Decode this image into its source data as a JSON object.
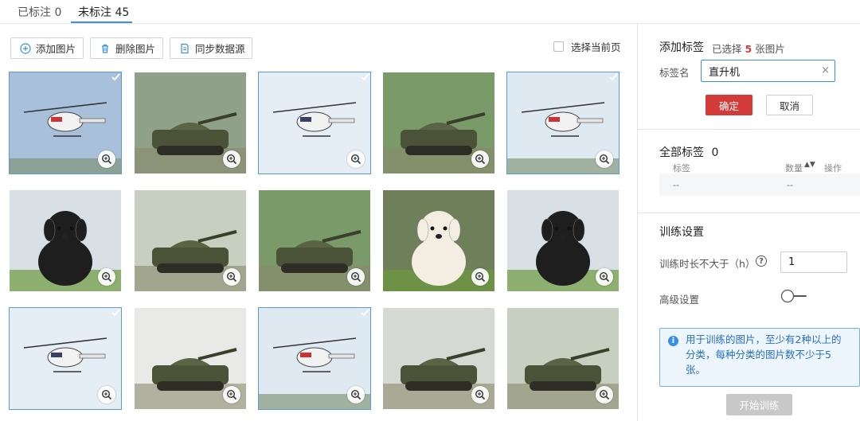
{
  "tabs": [
    {
      "label": "已标注 0"
    },
    {
      "label": "未标注 45"
    }
  ],
  "toolbar": {
    "add_label": "添加图片",
    "delete_label": "删除图片",
    "sync_label": "同步数据源",
    "select_page_label": "选择当前页"
  },
  "images": [
    {
      "subject": "helicopter",
      "selected": true
    },
    {
      "subject": "tank",
      "selected": false
    },
    {
      "subject": "helicopter",
      "selected": true
    },
    {
      "subject": "tank",
      "selected": false
    },
    {
      "subject": "helicopter",
      "selected": true
    },
    {
      "subject": "dog",
      "selected": false
    },
    {
      "subject": "tank",
      "selected": false
    },
    {
      "subject": "tank",
      "selected": false
    },
    {
      "subject": "dog",
      "selected": false
    },
    {
      "subject": "dog",
      "selected": false
    },
    {
      "subject": "helicopter",
      "selected": true
    },
    {
      "subject": "tank",
      "selected": false
    },
    {
      "subject": "helicopter",
      "selected": true
    },
    {
      "subject": "tank",
      "selected": false
    },
    {
      "subject": "tank",
      "selected": false
    }
  ],
  "add_tag": {
    "title": "添加标签",
    "selected_prefix": "已选择",
    "selected_count": "5",
    "selected_suffix": "张图片",
    "name_label": "标签名",
    "name_value": "直升机",
    "clear_icon": "×",
    "ok_label": "确定",
    "cancel_label": "取消"
  },
  "all_tags": {
    "title": "全部标签",
    "count": "0",
    "col_tag": "标签",
    "col_count": "数量",
    "col_action": "操作",
    "row_tag": "--",
    "row_count": "--"
  },
  "training": {
    "title": "训练设置",
    "duration_label": "训练时长不大于（h）",
    "help_icon": "?",
    "duration_value": "1",
    "advanced_label": "高级设置",
    "info_line1": "用于训练的图片，至少有2种以上的",
    "info_line2": "分类，每种分类的图片数不少于5",
    "info_line3": "张。",
    "info_icon": "i",
    "start_label": "开始训练"
  },
  "colors": {
    "accent": "#3a8ee6",
    "danger": "#d33a3a",
    "selected_border": "#5b9bd5",
    "disabled": "#c8c8c8"
  }
}
